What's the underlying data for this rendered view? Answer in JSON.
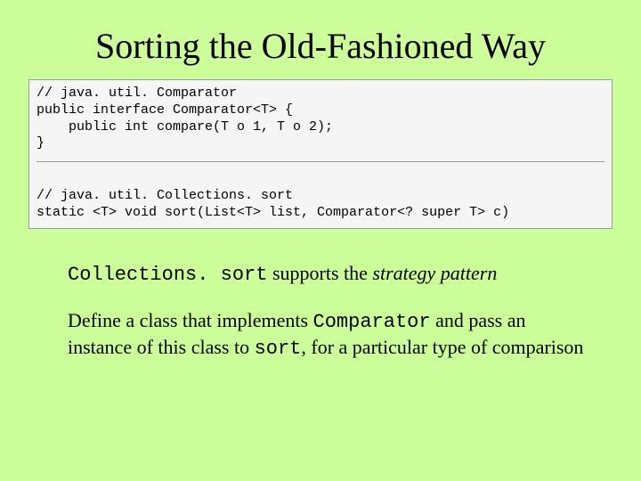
{
  "title": "Sorting the Old-Fashioned Way",
  "code": {
    "c1": "// java. util. Comparator",
    "c2": "public interface Comparator<T> {",
    "c3": "    public int compare(T o 1, T o 2);",
    "c4": "}",
    "c5": "// java. util. Collections. sort",
    "c6": "static <T> void sort(List<T> list, Comparator<? super T> c)"
  },
  "para1": {
    "mono1": "Collections. sort",
    "t1": " supports the ",
    "ital1": "strategy pattern"
  },
  "para2": {
    "t1": "Define a class that implements ",
    "mono1": "Comparator",
    "t2": " and pass an instance of this class to ",
    "mono2": "sort",
    "t3": ", for a particular type of comparison"
  }
}
